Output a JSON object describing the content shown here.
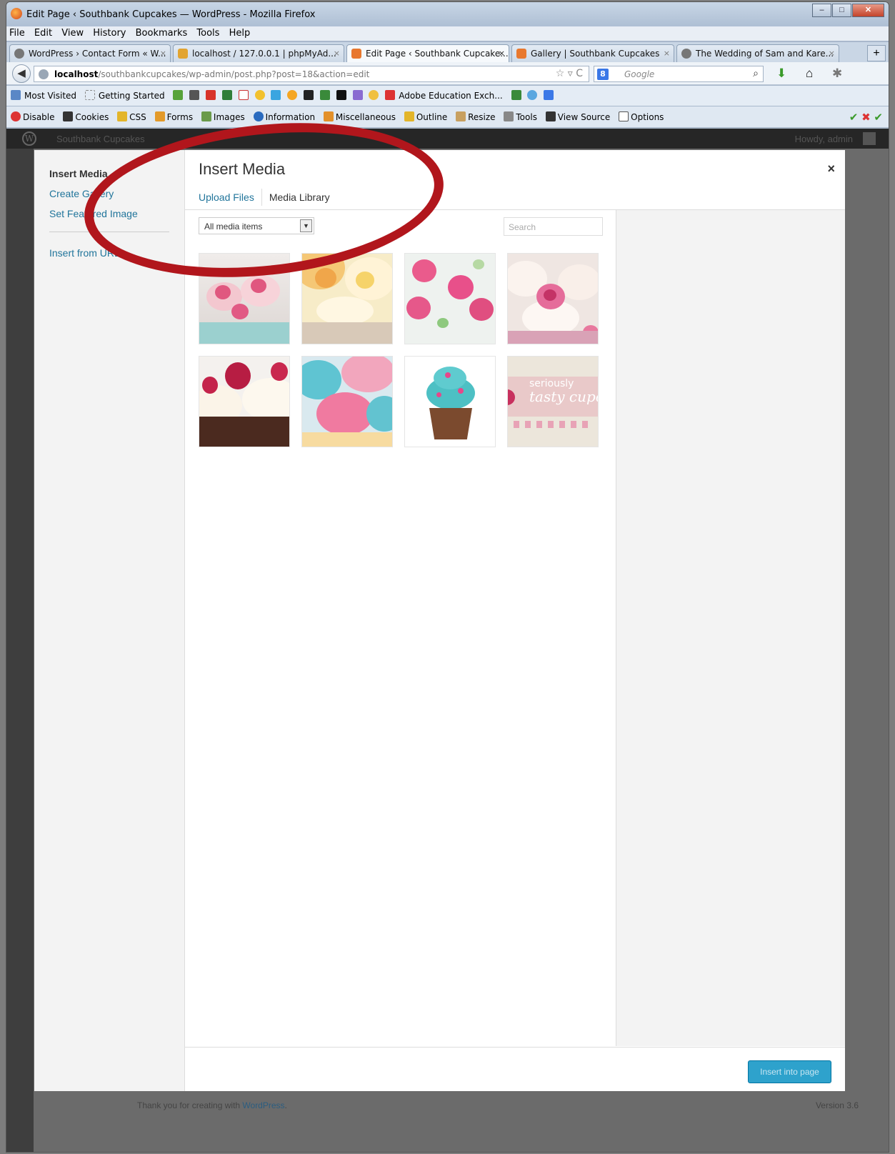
{
  "window": {
    "title": "Edit Page ‹ Southbank Cupcakes — WordPress - Mozilla Firefox"
  },
  "menubar": [
    "File",
    "Edit",
    "View",
    "History",
    "Bookmarks",
    "Tools",
    "Help"
  ],
  "tabs": [
    {
      "label": "WordPress › Contact Form « W...",
      "close": "×"
    },
    {
      "label": "localhost / 127.0.0.1 | phpMyAd...",
      "close": "×"
    },
    {
      "label": "Edit Page ‹ Southbank Cupcake...",
      "close": "×"
    },
    {
      "label": "Gallery | Southbank Cupcakes",
      "close": "×"
    },
    {
      "label": "The Wedding of Sam and Kare...",
      "close": "×"
    }
  ],
  "new_tab": "+",
  "nav": {
    "url_host": "localhost",
    "url_path": "/southbankcupcakes/wp-admin/post.php?post=18&action=edit",
    "search_placeholder": "Google",
    "search_engine_letter": "8"
  },
  "bookmarks": [
    "Most Visited",
    "Getting Started",
    "Adobe Education Exch..."
  ],
  "devbar": [
    "Disable",
    "Cookies",
    "CSS",
    "Forms",
    "Images",
    "Information",
    "Miscellaneous",
    "Outline",
    "Resize",
    "Tools",
    "View Source",
    "Options"
  ],
  "wp": {
    "site_name": "Southbank Cupcakes",
    "howdy": "Howdy, admin",
    "footer_text": "Thank you for creating with ",
    "footer_link": "WordPress",
    "footer_end": ".",
    "version": "Version 3.6"
  },
  "modal": {
    "menu": {
      "insert_media": "Insert Media",
      "create_gallery": "Create Gallery",
      "set_featured": "Set Featured Image",
      "insert_url": "Insert from URL"
    },
    "title": "Insert Media",
    "close": "×",
    "tabs": {
      "upload": "Upload Files",
      "library": "Media Library"
    },
    "filter": "All media items",
    "search_placeholder": "Search",
    "insert_button": "Insert into page"
  },
  "thumbnails": [
    {
      "name": "pink rose cupcakes"
    },
    {
      "name": "yellow rose cupcakes"
    },
    {
      "name": "pink roses on white frosting"
    },
    {
      "name": "pink flower cupcakes"
    },
    {
      "name": "raspberry chocolate cupcakes"
    },
    {
      "name": "blue and pink swirl cupcakes"
    },
    {
      "name": "teal frosted cupcake"
    },
    {
      "name": "seriously tasty cupcakes banner",
      "text": "seriously",
      "text2": "tasty cupc"
    }
  ],
  "colors": {
    "accent": "#2ea2cc",
    "link": "#21759b",
    "annotation": "#b1161c"
  }
}
